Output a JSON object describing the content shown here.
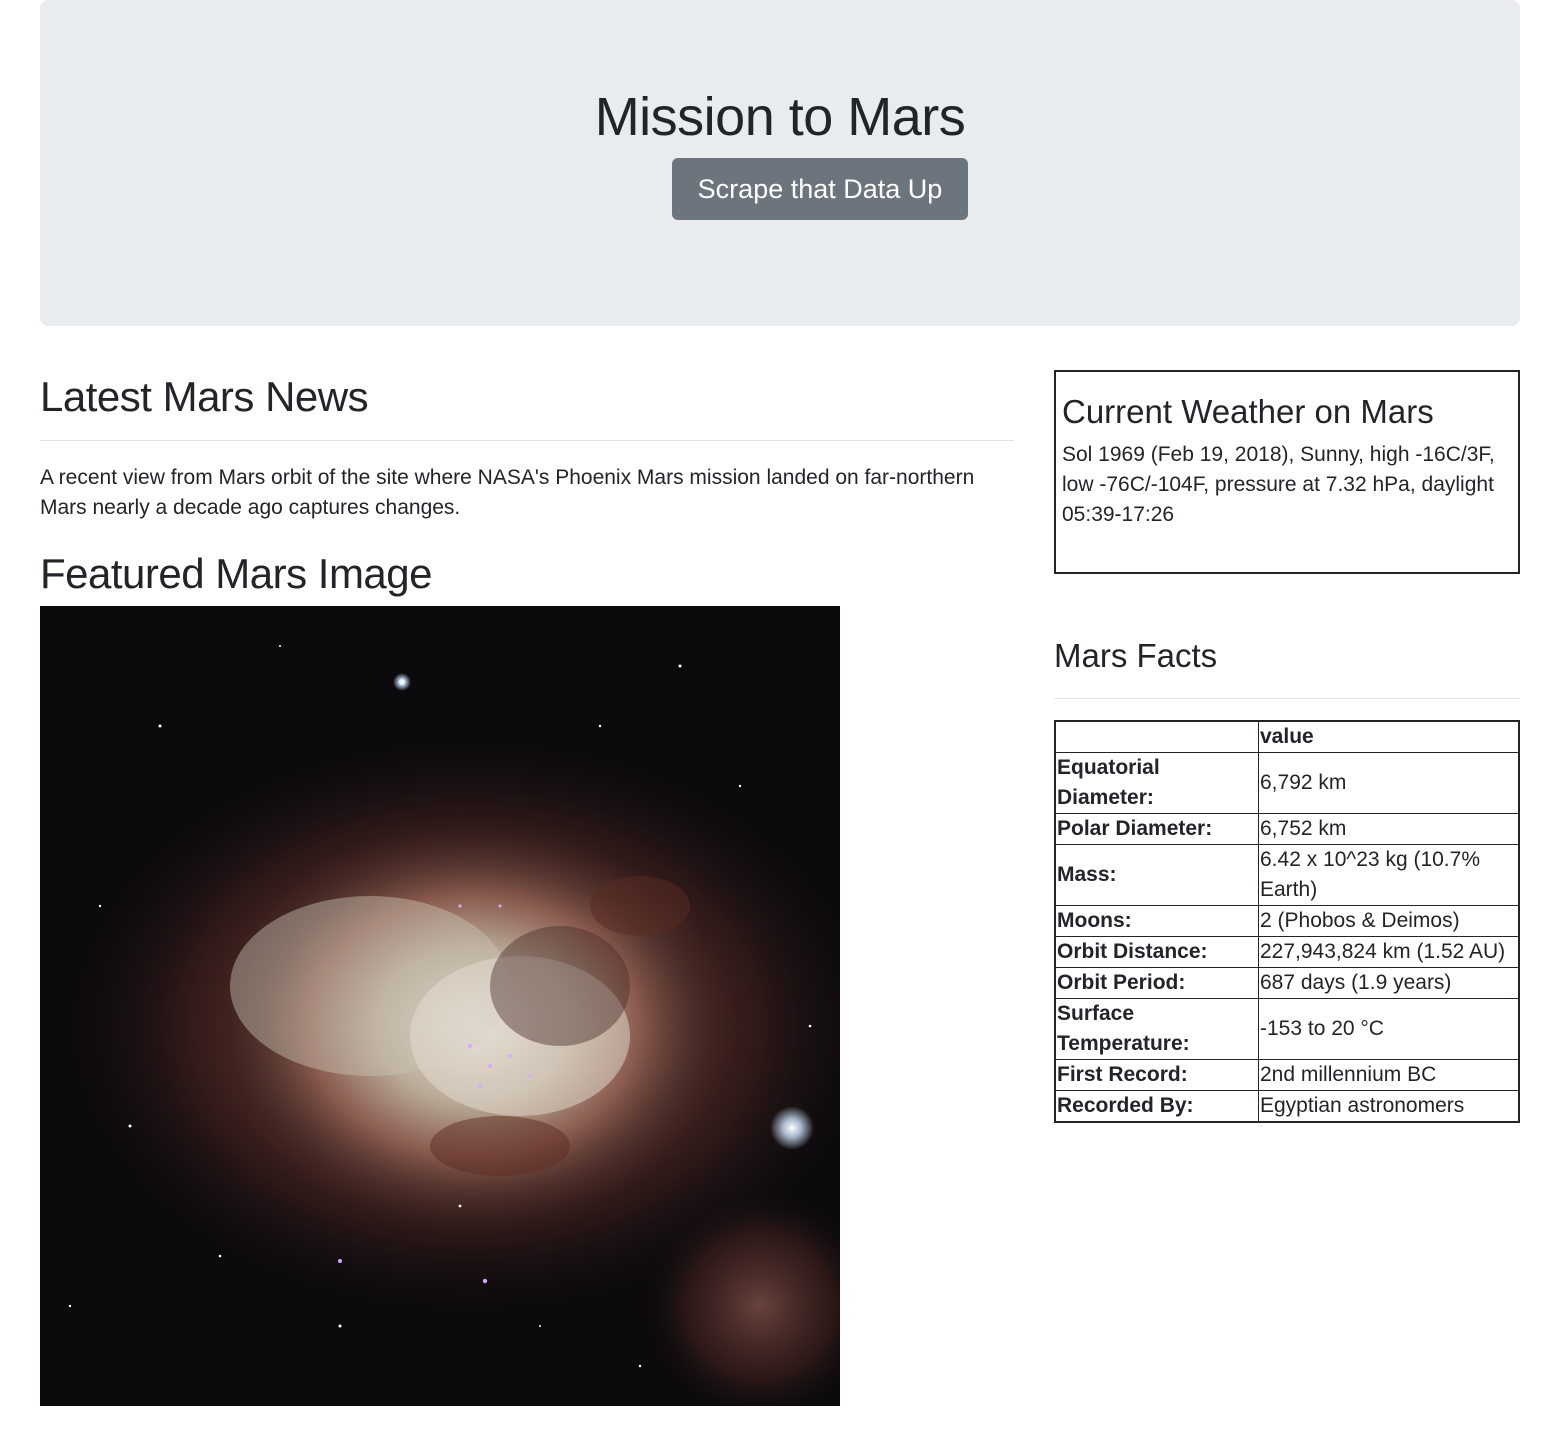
{
  "header": {
    "title": "Mission to Mars",
    "button_label": "Scrape that Data Up"
  },
  "news": {
    "heading": "Latest Mars News",
    "paragraph": "A recent view from Mars orbit of the site where NASA's Phoenix Mars mission landed on far-northern Mars nearly a decade ago captures changes."
  },
  "featured": {
    "heading": "Featured Mars Image",
    "image_icon": "nebula-image"
  },
  "weather": {
    "heading": "Current Weather on Mars",
    "text": "Sol 1969 (Feb 19, 2018), Sunny, high -16C/3F, low -76C/-104F, pressure at 7.32 hPa, daylight 05:39-17:26"
  },
  "facts": {
    "heading": "Mars Facts",
    "column_header": "value",
    "rows": [
      {
        "label": "Equatorial Diameter:",
        "value": "6,792 km"
      },
      {
        "label": "Polar Diameter:",
        "value": "6,752 km"
      },
      {
        "label": "Mass:",
        "value": "6.42 x 10^23 kg (10.7% Earth)"
      },
      {
        "label": "Moons:",
        "value": "2 (Phobos & Deimos)"
      },
      {
        "label": "Orbit Distance:",
        "value": "227,943,824 km (1.52 AU)"
      },
      {
        "label": "Orbit Period:",
        "value": "687 days (1.9 years)"
      },
      {
        "label": "Surface Temperature:",
        "value": "-153 to 20 °C"
      },
      {
        "label": "First Record:",
        "value": "2nd millennium BC"
      },
      {
        "label": "Recorded By:",
        "value": "Egyptian astronomers"
      }
    ]
  },
  "colors": {
    "jumbotron_bg": "#e9ecef",
    "button_bg": "#6c757d",
    "text": "#212529"
  }
}
